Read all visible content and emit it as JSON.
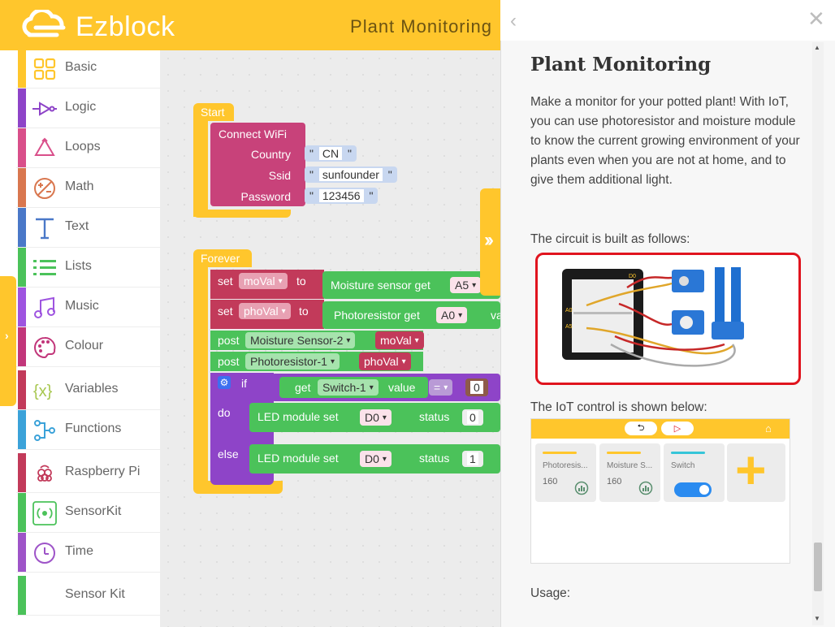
{
  "header": {
    "brand": "Ezblock",
    "project_title": "Plant Monitoring"
  },
  "sidebar": {
    "items": [
      {
        "label": "Basic",
        "color": "#FFC62C",
        "icon": "grid-icon"
      },
      {
        "label": "Logic",
        "color": "#8E44C8",
        "icon": "logic-gate-icon"
      },
      {
        "label": "Loops",
        "color": "#D94F8A",
        "icon": "loop-arrows-icon"
      },
      {
        "label": "Math",
        "color": "#D9774F",
        "icon": "math-symbols-icon"
      },
      {
        "label": "Text",
        "color": "#4A78C8",
        "icon": "text-t-icon"
      },
      {
        "label": "Lists",
        "color": "#4BC25A",
        "icon": "list-icon"
      },
      {
        "label": "Music",
        "color": "#9E54E0",
        "icon": "music-note-icon"
      },
      {
        "label": "Colour",
        "color": "#C2367A",
        "icon": "palette-icon"
      },
      {
        "label": "Variables",
        "color": "#C23A5A",
        "icon": "variable-braces-icon"
      },
      {
        "label": "Functions",
        "color": "#3BA2D9",
        "icon": "functions-flow-icon"
      },
      {
        "label": "Raspberry Pi",
        "color": "#C23A5A",
        "icon": "raspberry-icon"
      },
      {
        "label": "SensorKit",
        "color": "#4BC25A",
        "icon": "sensor-wave-icon"
      },
      {
        "label": "Time",
        "color": "#9E54C8",
        "icon": "clock-icon"
      },
      {
        "label": "Sensor Kit",
        "color": "#4BC25A",
        "icon": ""
      }
    ]
  },
  "blocks": {
    "start_label": "Start",
    "connect_wifi": "Connect WiFi",
    "country_label": "Country",
    "country_value": "CN",
    "ssid_label": "Ssid",
    "ssid_value": "sunfounder",
    "password_label": "Password",
    "password_value": "123456",
    "forever_label": "Forever",
    "set_label": "set",
    "to_label": "to",
    "var_moval": "moVal",
    "var_phoval": "phoVal",
    "moisture_get": "Moisture sensor get",
    "moisture_pin": "A5",
    "photo_get": "Photoresistor get",
    "photo_pin": "A0",
    "photo_trail": "va",
    "post_label": "post",
    "post1_target": "Moisture Sensor-2",
    "post2_target": "Photoresistor-1",
    "if_label": "if",
    "get_label": "get",
    "switch_target": "Switch-1",
    "value_label": "value",
    "eq_op": "=",
    "cmp_value": "0",
    "do_label": "do",
    "else_label": "else",
    "led_set": "LED module set",
    "led_pin": "D0",
    "status_label": "status",
    "status_off": "0",
    "status_on": "1"
  },
  "panel": {
    "title": "Plant Monitoring",
    "description": "Make a monitor for your potted plant! With IoT, you can use photoresistor and moisture module to know the current growing environment of your plants even when you are not at home, and to give them additional light.",
    "circuit_heading": "The circuit is built as follows:",
    "iot_heading": "The IoT control is shown below:",
    "usage_heading": "Usage:",
    "iot_cards": [
      {
        "name": "Photoresis...",
        "value": "160",
        "line_color": "#FFC62C"
      },
      {
        "name": "Moisture S...",
        "value": "160",
        "line_color": "#FFC62C"
      },
      {
        "name": "Switch",
        "value": "",
        "line_color": "#36C5D8"
      }
    ],
    "add_widget": "+"
  },
  "colors": {
    "brand_yellow": "#FFC62C",
    "block_pink": "#C8427A",
    "block_red": "#C23A5A",
    "block_green": "#4BC25A",
    "block_purple": "#8E44C8",
    "highlight_red": "#E0141E"
  }
}
